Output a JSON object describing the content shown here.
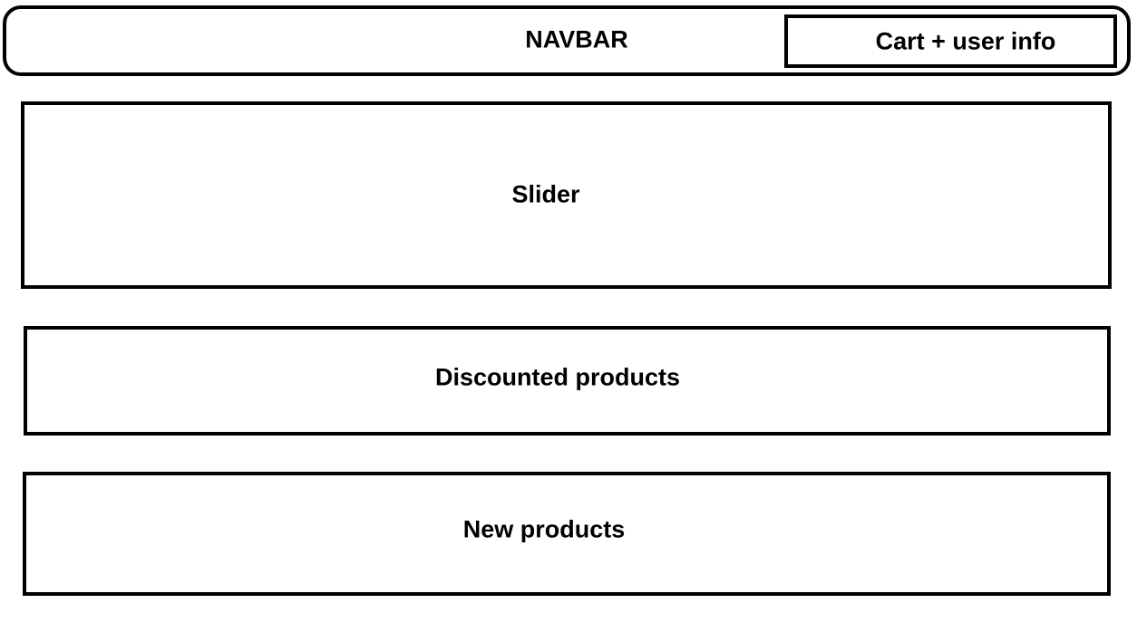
{
  "navbar": {
    "label": "NAVBAR",
    "cart_label": "Cart + user info"
  },
  "slider": {
    "label": "Slider"
  },
  "discounted": {
    "label": "Discounted products"
  },
  "new_products": {
    "label": "New products"
  }
}
